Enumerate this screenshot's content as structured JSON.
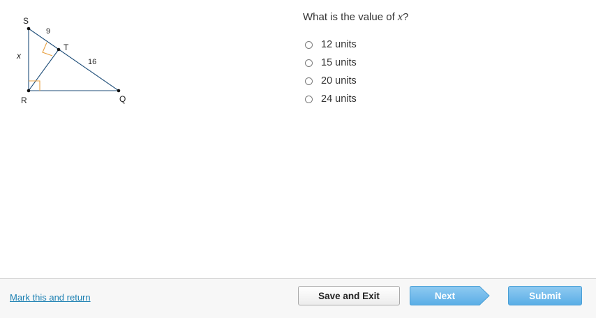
{
  "figure": {
    "vertex_s": "S",
    "vertex_t": "T",
    "vertex_r": "R",
    "vertex_q": "Q",
    "label_st": "9",
    "label_tq": "16",
    "label_x": "x",
    "line_color": "#1f4e79",
    "right_angle_color": "#e8a040"
  },
  "question": {
    "prefix": "What is the value of ",
    "variable": "x",
    "suffix": "?"
  },
  "options": [
    {
      "label": "12 units",
      "selected": false
    },
    {
      "label": "15 units",
      "selected": false
    },
    {
      "label": "20 units",
      "selected": false
    },
    {
      "label": "24 units",
      "selected": false
    }
  ],
  "footer": {
    "mark_label": "Mark this and return",
    "save_label": "Save and Exit",
    "next_label": "Next",
    "submit_label": "Submit"
  }
}
